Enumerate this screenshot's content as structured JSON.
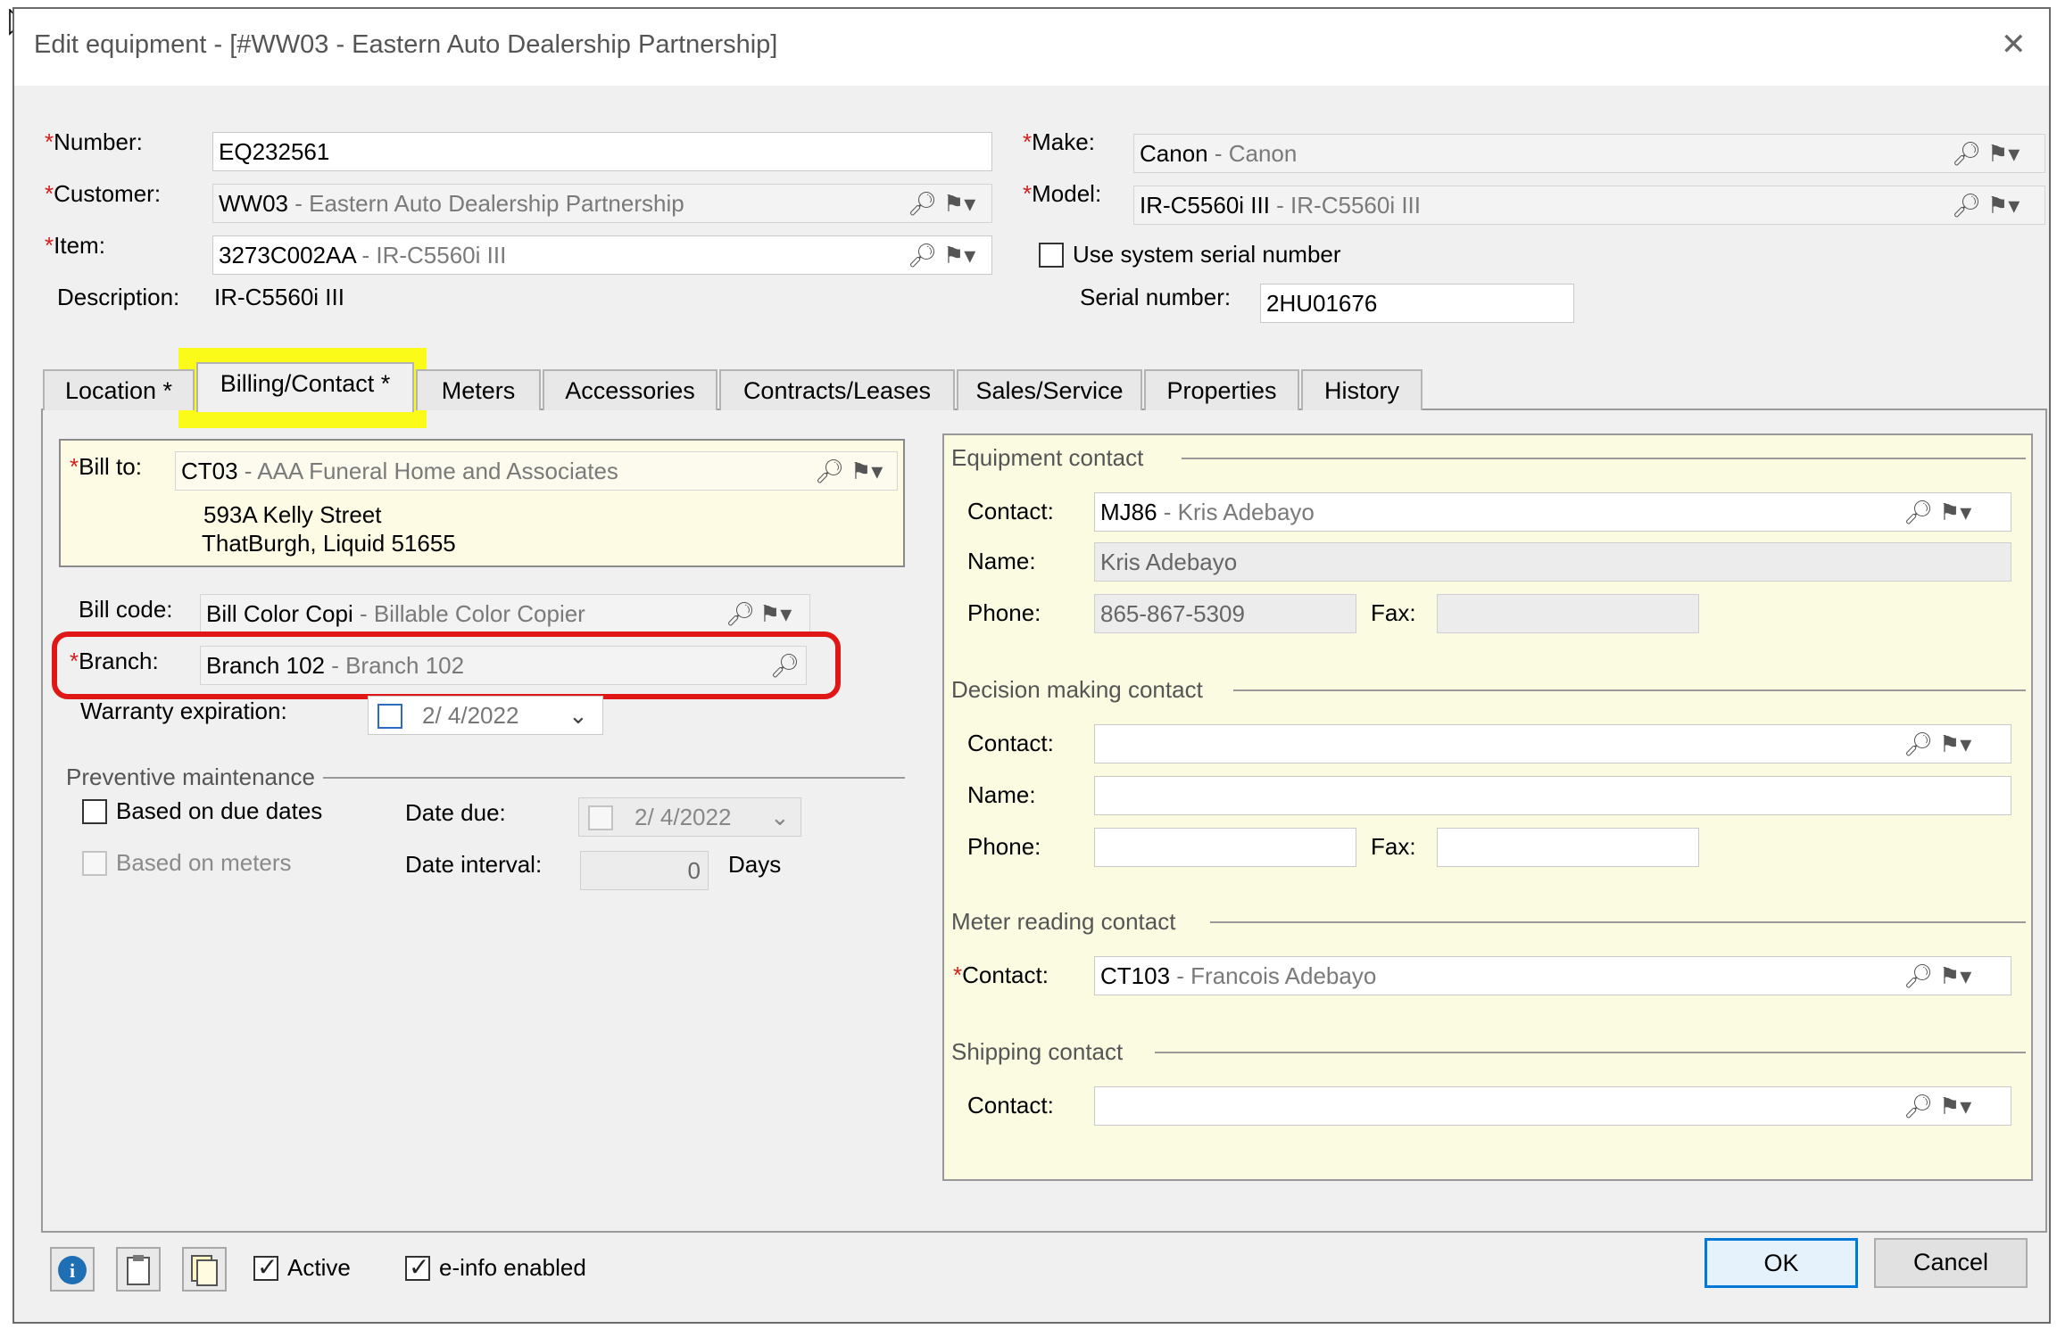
{
  "window": {
    "title": "Edit equipment - [#WW03 - Eastern Auto Dealership Partnership]",
    "close_glyph": "✕"
  },
  "header": {
    "number": {
      "label": "Number:",
      "value": "EQ232561"
    },
    "customer": {
      "label": "Customer:",
      "code": "WW03",
      "desc": " - Eastern Auto Dealership Partnership"
    },
    "item": {
      "label": "Item:",
      "code": "3273C002AA",
      "desc": " - IR-C5560i III"
    },
    "description": {
      "label": "Description:",
      "value": "IR-C5560i III"
    },
    "make": {
      "label": "Make:",
      "code": "Canon",
      "desc": " - Canon"
    },
    "model": {
      "label": "Model:",
      "code": "IR-C5560i III",
      "desc": " - IR-C5560i III"
    },
    "use_system_serial": {
      "label": "Use system serial number",
      "checked": false
    },
    "serial_number": {
      "label": "Serial number:",
      "value": "2HU01676"
    }
  },
  "tabs": [
    {
      "label": "Location *"
    },
    {
      "label": "Billing/Contact *",
      "active": true
    },
    {
      "label": "Meters"
    },
    {
      "label": "Accessories"
    },
    {
      "label": "Contracts/Leases"
    },
    {
      "label": "Sales/Service"
    },
    {
      "label": "Properties"
    },
    {
      "label": "History"
    }
  ],
  "billing": {
    "bill_to": {
      "label": "Bill to:",
      "code": "CT03",
      "desc": " - AAA Funeral Home and Associates",
      "address_line1": "593A Kelly Street",
      "address_line2": "ThatBurgh, Liquid 51655"
    },
    "bill_code": {
      "label": "Bill code:",
      "code": "Bill Color Copi",
      "desc": " - Billable Color Copier"
    },
    "branch": {
      "label": "Branch:",
      "code": "Branch 102",
      "desc": " - Branch 102"
    },
    "warranty": {
      "label": "Warranty expiration:",
      "value": "2/  4/2022"
    },
    "pm": {
      "title": "Preventive maintenance",
      "due_dates": {
        "label": "Based on due dates",
        "checked": false
      },
      "meters": {
        "label": "Based on meters",
        "checked": false
      },
      "date_due": {
        "label": "Date due:",
        "value": "2/  4/2022"
      },
      "date_interval": {
        "label": "Date interval:",
        "value": "0",
        "unit": "Days"
      }
    }
  },
  "contacts": {
    "equipment": {
      "title": "Equipment contact",
      "contact_label": "Contact:",
      "code": "MJ86",
      "desc": " - Kris Adebayo",
      "name_label": "Name:",
      "name": "Kris Adebayo",
      "phone_label": "Phone:",
      "phone": "865-867-5309",
      "fax_label": "Fax:",
      "fax": ""
    },
    "decision": {
      "title": "Decision making contact",
      "contact_label": "Contact:",
      "name_label": "Name:",
      "phone_label": "Phone:",
      "fax_label": "Fax:"
    },
    "meter": {
      "title": "Meter reading contact",
      "contact_label": "Contact:",
      "code": "CT103",
      "desc": " - Francois Adebayo"
    },
    "shipping": {
      "title": "Shipping contact",
      "contact_label": "Contact:"
    }
  },
  "footer": {
    "active": {
      "label": "Active",
      "checked": true
    },
    "einfo": {
      "label": "e-info enabled",
      "checked": true
    },
    "ok": "OK",
    "cancel": "Cancel"
  },
  "glyphs": {
    "lookup": "⌕",
    "flag": "⚑▾",
    "info": "i",
    "required": "*"
  }
}
